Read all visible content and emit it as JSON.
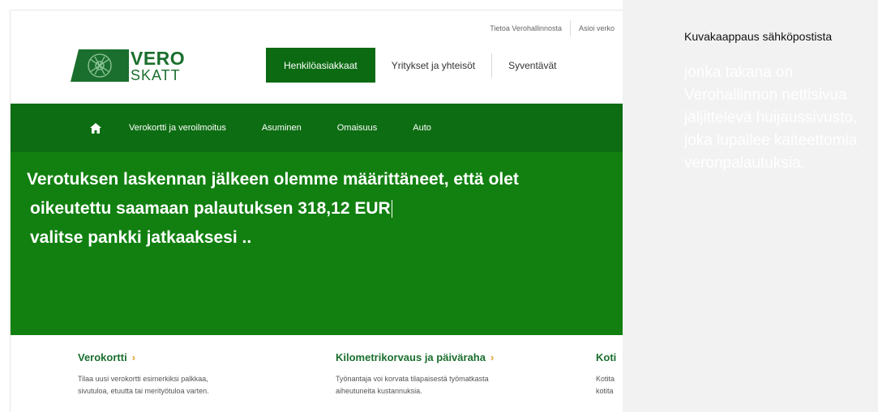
{
  "top_links": [
    "Tietoa Verohallinnosta",
    "Asioi verko"
  ],
  "logo": {
    "line1": "VERO",
    "line2": "SKATT",
    "icon": "vero-emblem-icon"
  },
  "main_nav": {
    "tabs": [
      "Henkilöasiakkaat",
      "Yritykset ja yhteisöt",
      "Syventävät"
    ]
  },
  "sub_nav": {
    "home_icon": "home-icon",
    "items": [
      "Verokortti ja veroilmoitus",
      "Asuminen",
      "Omaisuus",
      "Auto"
    ]
  },
  "hero": {
    "line1": "Verotuksen laskennan jälkeen olemme määrittäneet,  että olet",
    "line2": "oikeutettu saamaan palautuksen 318,12 EUR",
    "line3": "valitse pankki jatkaaksesi .."
  },
  "cards": [
    {
      "title": "Verokortti",
      "chevron": "›",
      "text1": "Tilaa uusi verokortti esimerkiksi palkkaa,",
      "text2": "sivutuloa, etuutta tai merityötuloa varten."
    },
    {
      "title": "Kilometrikorvaus ja päiväraha",
      "chevron": "›",
      "text1": "Työnantaja voi korvata tilapaisestä työmatkasta",
      "text2": "aiheutuneita kustannuksia."
    },
    {
      "title": "Koti",
      "chevron": "",
      "text1": "Kotita",
      "text2": "kotita"
    }
  ],
  "caption": {
    "title": "Kuvakaappaus sähköpostista",
    "body": "jonka takana on Verohallinnon nettisivua jäljittelevä huijaussivusto, joka lupailee kaiteettomia veronpalautuksia."
  },
  "colors": {
    "brand_green": "#1b6f2e",
    "nav_active": "#0c6b12",
    "greenbar": "#0d6d12",
    "hero": "#118010",
    "chevron": "#e0a22c"
  }
}
